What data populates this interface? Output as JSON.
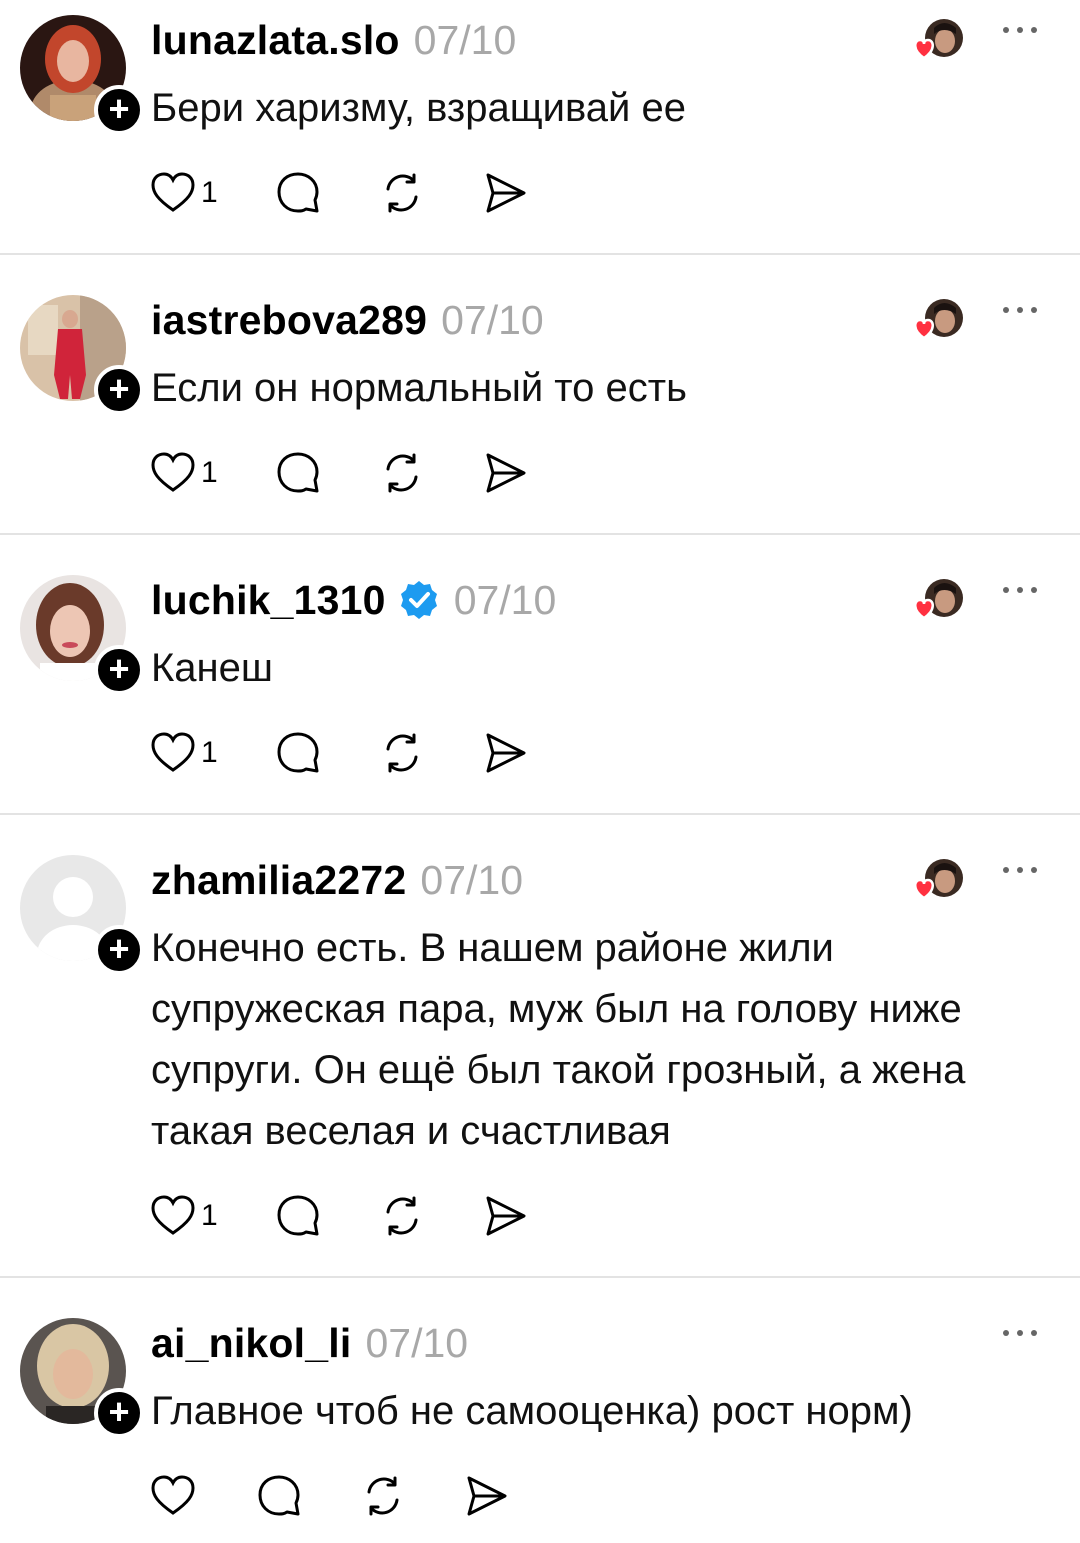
{
  "posts": [
    {
      "username": "lunazlata.slo",
      "date": "07/10",
      "verified": false,
      "text": "Бери харизму, взращивай ее",
      "likes": "1",
      "liked_by_creator": true
    },
    {
      "username": "iastrebova289",
      "date": "07/10",
      "verified": false,
      "text": "Если он нормальный то есть",
      "likes": "1",
      "liked_by_creator": true
    },
    {
      "username": "luchik_1310",
      "date": "07/10",
      "verified": true,
      "text": "Канеш",
      "likes": "1",
      "liked_by_creator": true
    },
    {
      "username": "zhamilia2272",
      "date": "07/10",
      "verified": false,
      "text": "Конечно есть. В нашем районе жили супружеская пара, муж был на голову ниже супруги. Он ещё был такой грозный, а жена такая веселая и счастливая",
      "likes": "1",
      "liked_by_creator": true
    },
    {
      "username": "ai_nikol_li",
      "date": "07/10",
      "verified": false,
      "text": "Главное чтоб не самооценка) рост норм)",
      "likes": "",
      "liked_by_creator": false
    }
  ],
  "icons": {
    "follow": "plus-icon",
    "like": "heart-icon",
    "reply": "comment-bubble-icon",
    "repost": "repost-icon",
    "share": "send-icon",
    "more": "more-dots-icon",
    "verified": "verified-badge-icon",
    "creator_liked": "creator-liked-heart-icon"
  },
  "colors": {
    "date": "#a8a8a8",
    "divider": "#e3e3e3",
    "verified": "#1d9bf0",
    "heart_red": "#ff3040"
  }
}
